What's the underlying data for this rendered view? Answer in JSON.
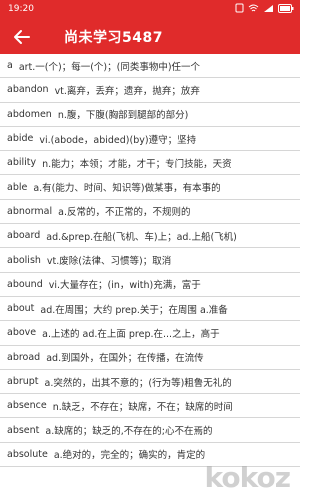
{
  "status_bar": {
    "time": "19:20",
    "icons": [
      "sim-icon",
      "wifi-icon",
      "signal-icon",
      "battery-icon"
    ]
  },
  "app_bar": {
    "title": "尚未学习5487",
    "back_icon": "back-arrow-icon"
  },
  "words": [
    {
      "word": "a",
      "def": "art.一(个)；每一(个)；(同类事物中)任一个"
    },
    {
      "word": "abandon",
      "def": "vt.离弃，丢弃；遗弃，抛弃；放弃"
    },
    {
      "word": "abdomen",
      "def": "n.腹，下腹(胸部到腿部的部分)"
    },
    {
      "word": "abide",
      "def": "vi.(abode，abided)(by)遵守；坚持"
    },
    {
      "word": "ability",
      "def": "n.能力；本领；才能，才干；专门技能，天资"
    },
    {
      "word": "able",
      "def": "a.有(能力、时间、知识等)做某事，有本事的"
    },
    {
      "word": "abnormal",
      "def": "a.反常的，不正常的，不规则的"
    },
    {
      "word": "aboard",
      "def": "ad.&prep.在船(飞机、车)上；ad.上船(飞机)"
    },
    {
      "word": "abolish",
      "def": "vt.废除(法律、习惯等)；取消"
    },
    {
      "word": "abound",
      "def": "vi.大量存在；(in，with)充满，富于"
    },
    {
      "word": "about",
      "def": "ad.在周围；大约 prep.关于；在周围 a.准备"
    },
    {
      "word": "above",
      "def": "a.上述的 ad.在上面 prep.在...之上，高于"
    },
    {
      "word": "abroad",
      "def": "ad.到国外，在国外；在传播，在流传"
    },
    {
      "word": "abrupt",
      "def": "a.突然的，出其不意的；(行为等)粗鲁无礼的"
    },
    {
      "word": "absence",
      "def": "n.缺乏，不存在；缺席，不在；缺席的时间"
    },
    {
      "word": "absent",
      "def": "a.缺席的；缺乏的,不存在的;心不在焉的"
    },
    {
      "word": "absolute",
      "def": "a.绝对的，完全的；确实的，肯定的"
    }
  ],
  "watermark": "kokoz"
}
